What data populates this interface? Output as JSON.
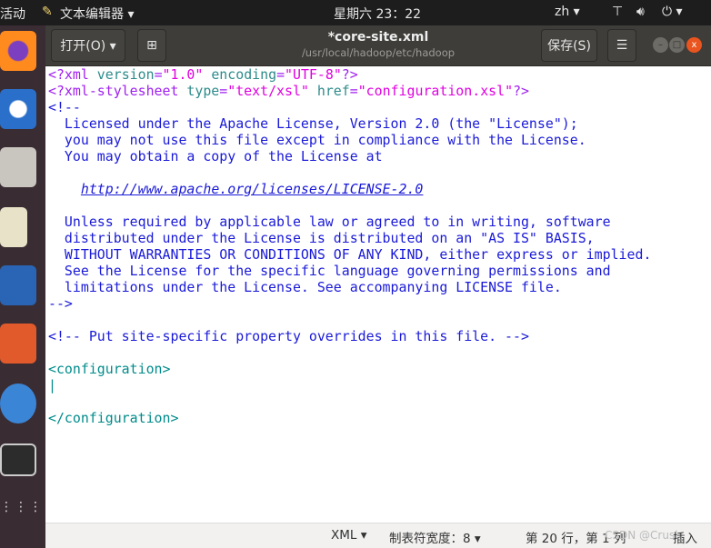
{
  "topbar": {
    "activities": "活动",
    "app_menu": "文本编辑器 ▾",
    "clock": "星期六 23：22",
    "lang": "zh ▾",
    "power": "⏻ ▾"
  },
  "header": {
    "open": "打开(O) ▾",
    "title": "*core-site.xml",
    "path": "/usr/local/hadoop/etc/hadoop",
    "save": "保存(S)",
    "menu": "☰"
  },
  "lines": [
    [
      [
        "pi",
        "<?xml "
      ],
      [
        "at",
        "version"
      ],
      [
        "pi",
        "="
      ],
      [
        "st",
        "\"1.0\""
      ],
      [
        "pi",
        " "
      ],
      [
        "at",
        "encoding"
      ],
      [
        "pi",
        "="
      ],
      [
        "st",
        "\"UTF-8\""
      ],
      [
        "pi",
        "?>"
      ]
    ],
    [
      [
        "pi",
        "<?xml-stylesheet "
      ],
      [
        "at",
        "type"
      ],
      [
        "pi",
        "="
      ],
      [
        "st",
        "\"text/xsl\""
      ],
      [
        "pi",
        " "
      ],
      [
        "at",
        "href"
      ],
      [
        "pi",
        "="
      ],
      [
        "st",
        "\"configuration.xsl\""
      ],
      [
        "pi",
        "?>"
      ]
    ],
    [
      [
        "cm",
        "<!--"
      ]
    ],
    [
      [
        "cm",
        "  Licensed under the Apache License, Version 2.0 (the \"License\");"
      ]
    ],
    [
      [
        "cm",
        "  you may not use this file except in compliance with the License."
      ]
    ],
    [
      [
        "cm",
        "  You may obtain a copy of the License at"
      ]
    ],
    [],
    [
      [
        "cm",
        "    "
      ],
      [
        "lk",
        "http://www.apache.org/licenses/LICENSE-2.0"
      ]
    ],
    [],
    [
      [
        "cm",
        "  Unless required by applicable law or agreed to in writing, software"
      ]
    ],
    [
      [
        "cm",
        "  distributed under the License is distributed on an \"AS IS\" BASIS,"
      ]
    ],
    [
      [
        "cm",
        "  WITHOUT WARRANTIES OR CONDITIONS OF ANY KIND, either express or implied."
      ]
    ],
    [
      [
        "cm",
        "  See the License for the specific language governing permissions and"
      ]
    ],
    [
      [
        "cm",
        "  limitations under the License. See accompanying LICENSE file."
      ]
    ],
    [
      [
        "cm",
        "-->"
      ]
    ],
    [],
    [
      [
        "cm",
        "<!-- Put site-specific property overrides in this file. -->"
      ]
    ],
    [],
    [
      [
        "tg",
        "<configuration>"
      ]
    ],
    [
      [
        "tg",
        "|"
      ]
    ],
    [],
    [
      [
        "tg",
        "</configuration>"
      ]
    ]
  ],
  "status": {
    "lang": "XML ▾",
    "tab": "制表符宽度：8 ▾",
    "pos": "第 20 行，第 1 列",
    "mode": "插入",
    "watermark": "CSDN @Crush"
  }
}
